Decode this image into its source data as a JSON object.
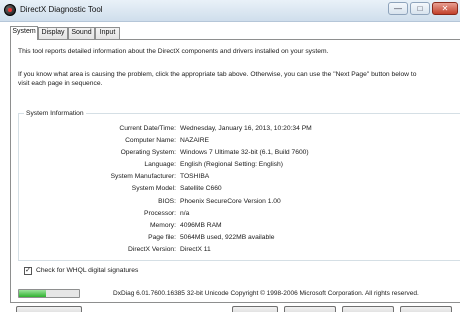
{
  "window": {
    "title": "DirectX Diagnostic Tool",
    "minimize_glyph": "—",
    "maximize_glyph": "□",
    "close_glyph": "✕",
    "close_color": "#c2412b"
  },
  "tabs": [
    {
      "label": "System",
      "active": true
    },
    {
      "label": "Display",
      "active": false
    },
    {
      "label": "Sound",
      "active": false
    },
    {
      "label": "Input",
      "active": false
    }
  ],
  "intro": {
    "line1": "This tool reports detailed information about the DirectX components and drivers installed on your system.",
    "line2": "If you know what area is causing the problem, click the appropriate tab above.  Otherwise, you can use the \"Next Page\" button below to",
    "line3": "visit each page in sequence."
  },
  "system_info": {
    "title": "System Information",
    "rows": [
      {
        "label": "Current Date/Time:",
        "value": "Wednesday, January 16, 2013, 10:20:34 PM"
      },
      {
        "label": "Computer Name:",
        "value": "NAZAIRE"
      },
      {
        "label": "Operating System:",
        "value": "Windows 7 Ultimate 32-bit (6.1, Build 7600)"
      },
      {
        "label": "Language:",
        "value": "English (Regional Setting: English)"
      },
      {
        "label": "System Manufacturer:",
        "value": "TOSHIBA"
      },
      {
        "label": "System Model:",
        "value": "Satellite C660"
      },
      {
        "label": "BIOS:",
        "value": "Phoenix SecureCore Version 1.00"
      },
      {
        "label": "Processor:",
        "value": "n/a"
      },
      {
        "label": "Memory:",
        "value": "4096MB RAM"
      },
      {
        "label": "Page file:",
        "value": "5064MB used, 922MB available"
      },
      {
        "label": "DirectX Version:",
        "value": "DirectX 11"
      }
    ]
  },
  "whql": {
    "label": "Check for WHQL digital signatures",
    "checked": true,
    "check_glyph": "✓"
  },
  "status": {
    "progress_fraction": 0.45,
    "progress_color": "#2fb12f",
    "copyright": "DxDiag 6.01.7600.16385 32-bit Unicode  Copyright © 1998-2006 Microsoft Corporation.  All rights reserved."
  },
  "icons": {
    "app": "directx-app-icon"
  }
}
